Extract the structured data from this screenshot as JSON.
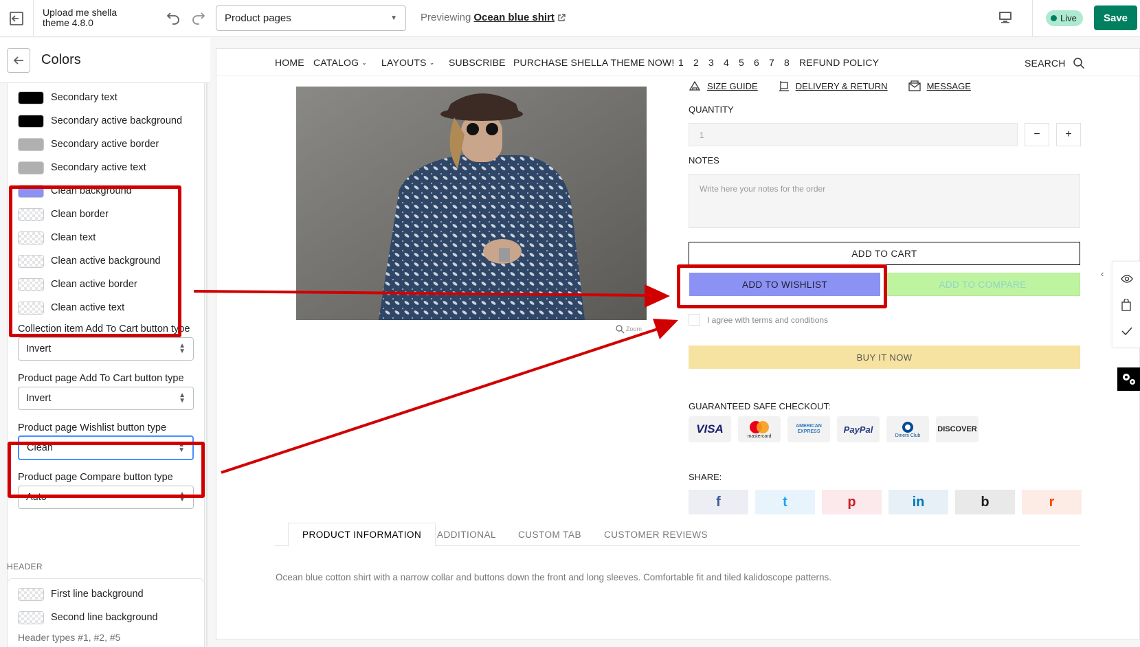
{
  "topbar": {
    "theme_name": "Upload me shella theme 4.8.0",
    "page_select": "Product pages",
    "previewing_label": "Previewing",
    "previewing_link": "Ocean blue shirt",
    "live_label": "Live",
    "save_label": "Save"
  },
  "sidebar": {
    "title": "Colors",
    "colors": [
      {
        "label": "Secondary text",
        "color": "#000000"
      },
      {
        "label": "Secondary active background",
        "color": "#000000"
      },
      {
        "label": "Secondary active border",
        "color": "#b0b0b0"
      },
      {
        "label": "Secondary active text",
        "color": "#b0b0b0"
      },
      {
        "label": "Clean background",
        "color": "#8c92f3"
      },
      {
        "label": "Clean border",
        "color": "transparent"
      },
      {
        "label": "Clean text",
        "color": "transparent"
      },
      {
        "label": "Clean active background",
        "color": "transparent"
      },
      {
        "label": "Clean active border",
        "color": "transparent"
      },
      {
        "label": "Clean active text",
        "color": "transparent"
      }
    ],
    "fields": [
      {
        "label": "Collection item Add To Cart button type",
        "value": "Invert"
      },
      {
        "label": "Product page Add To Cart button type",
        "value": "Invert"
      },
      {
        "label": "Product page Wishlist button type",
        "value": "Clean"
      },
      {
        "label": "Product page Compare button type",
        "value": "Auto"
      }
    ],
    "header_section": "HEADER",
    "header_colors": [
      {
        "label": "First line background",
        "color": "transparent"
      },
      {
        "label": "Second line background",
        "color": "transparent"
      }
    ],
    "hint": "Header types #1, #2, #5"
  },
  "store": {
    "nav": [
      "HOME",
      "CATALOG",
      "LAYOUTS",
      "SUBSCRIBE",
      "PURCHASE SHELLA THEME NOW!",
      "1",
      "2",
      "3",
      "4",
      "5",
      "6",
      "7",
      "8",
      "REFUND POLICY"
    ],
    "search_label": "SEARCH",
    "zoom_label": "Zoom",
    "info_links": [
      "SIZE GUIDE",
      "DELIVERY & RETURN",
      "MESSAGE"
    ],
    "quantity_label": "QUANTITY",
    "quantity_value": "1",
    "minus": "−",
    "plus": "+",
    "notes_label": "NOTES",
    "notes_placeholder": "Write here your notes for the order",
    "add_to_cart": "ADD TO CART",
    "add_to_wishlist": "ADD TO WISHLIST",
    "add_to_compare": "ADD TO COMPARE",
    "agree_text": "I agree with terms and conditions",
    "buy_now": "BUY IT NOW",
    "checkout_label": "GUARANTEED SAFE CHECKOUT:",
    "payments": [
      "VISA",
      "mastercard",
      "AMERICAN EXPRESS",
      "PayPal",
      "Diners Club",
      "DISCOVER"
    ],
    "share_label": "SHARE:",
    "share": [
      "f",
      "t",
      "p",
      "in",
      "b",
      "r"
    ],
    "tabs": [
      "PRODUCT INFORMATION",
      "ADDITIONAL",
      "CUSTOM TAB",
      "CUSTOMER REVIEWS"
    ],
    "description": "Ocean blue cotton shirt with a narrow collar and buttons down the front and long sleeves. Comfortable fit and tiled kalidoscope patterns."
  },
  "colors": {
    "accent_green": "#008060",
    "annotation_red": "#d10000",
    "wishlist_bg": "#8c92f3",
    "compare_bg": "#bef4a0",
    "buy_bg": "#f6e3a1"
  }
}
